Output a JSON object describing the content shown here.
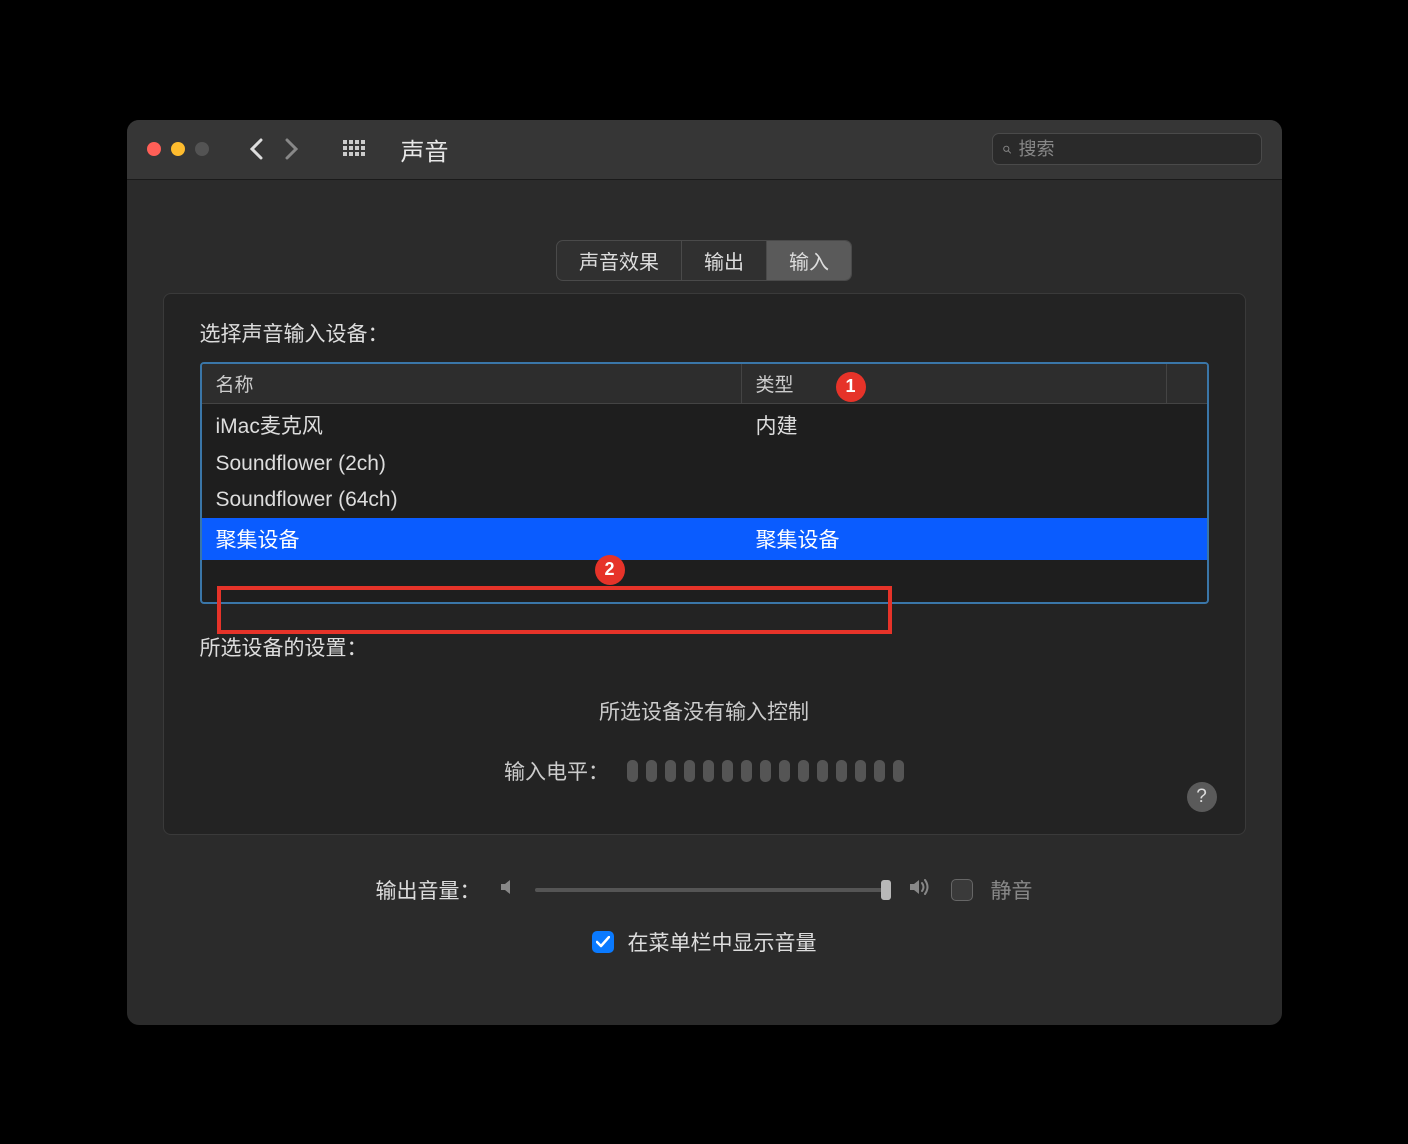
{
  "header": {
    "title": "声音",
    "search_placeholder": "搜索"
  },
  "tabs": [
    {
      "label": "声音效果",
      "active": false
    },
    {
      "label": "输出",
      "active": false
    },
    {
      "label": "输入",
      "active": true
    }
  ],
  "badges": {
    "b1": "1",
    "b2": "2"
  },
  "panel": {
    "choose_label": "选择声音输入设备：",
    "columns": {
      "name": "名称",
      "type": "类型"
    },
    "devices": [
      {
        "name": "iMac麦克风",
        "type": "内建",
        "selected": false
      },
      {
        "name": "Soundflower (2ch)",
        "type": "",
        "selected": false
      },
      {
        "name": "Soundflower (64ch)",
        "type": "",
        "selected": false
      },
      {
        "name": "聚集设备",
        "type": "聚集设备",
        "selected": true
      }
    ],
    "settings_label": "所选设备的设置：",
    "no_input_controls": "所选设备没有输入控制",
    "input_level_label": "输入电平：",
    "help": "?"
  },
  "footer": {
    "output_volume_label": "输出音量：",
    "mute_label": "静音",
    "show_in_menubar": "在菜单栏中显示音量"
  }
}
